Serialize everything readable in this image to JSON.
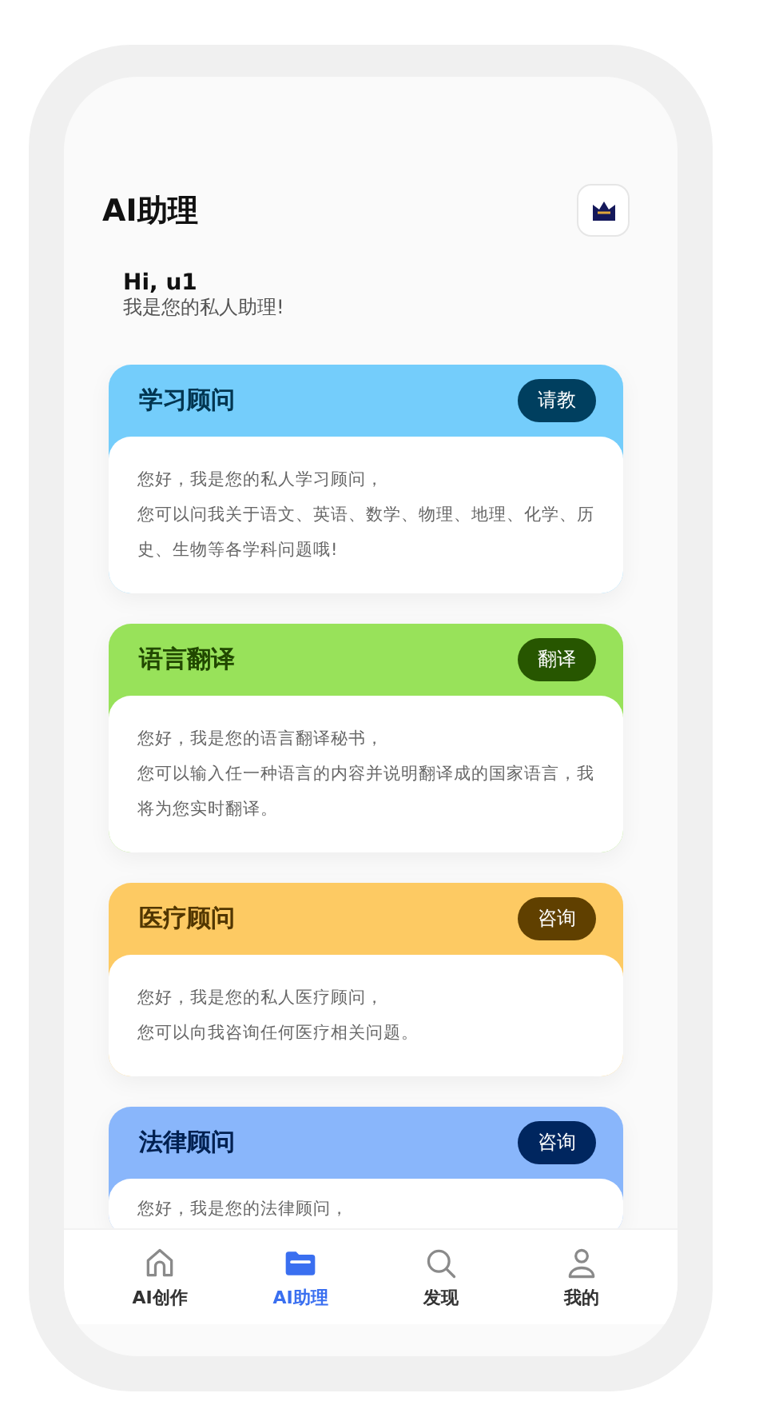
{
  "header": {
    "title": "AI助理"
  },
  "greeting": {
    "title": "Hi, u1",
    "subtitle": "我是您的私人助理!"
  },
  "assistants": [
    {
      "name": "学习顾问",
      "action": "请教",
      "color": "#74cdfb",
      "lines": [
        "您好，我是您的私人学习顾问，",
        "您可以问我关于语文、英语、数学、物理、地理、化学、历史、生物等各学科问题哦!"
      ]
    },
    {
      "name": "语言翻译",
      "action": "翻译",
      "color": "#98e25a",
      "lines": [
        "您好，我是您的语言翻译秘书，",
        "您可以输入任一种语言的内容并说明翻译成的国家语言，我将为您实时翻译。"
      ]
    },
    {
      "name": "医疗顾问",
      "action": "咨询",
      "color": "#fdca63",
      "lines": [
        "您好，我是您的私人医疗顾问，",
        "您可以向我咨询任何医疗相关问题。"
      ]
    },
    {
      "name": "法律顾问",
      "action": "咨询",
      "color": "#89b6fb",
      "lines": [
        "您好，我是您的法律顾问，"
      ]
    }
  ],
  "tab_bar": [
    {
      "label": "AI创作",
      "kind": "home",
      "selected": false
    },
    {
      "label": "AI助理",
      "kind": "folder",
      "selected": true
    },
    {
      "label": "发现",
      "kind": "search",
      "selected": false
    },
    {
      "label": "我的",
      "kind": "user",
      "selected": false
    }
  ]
}
